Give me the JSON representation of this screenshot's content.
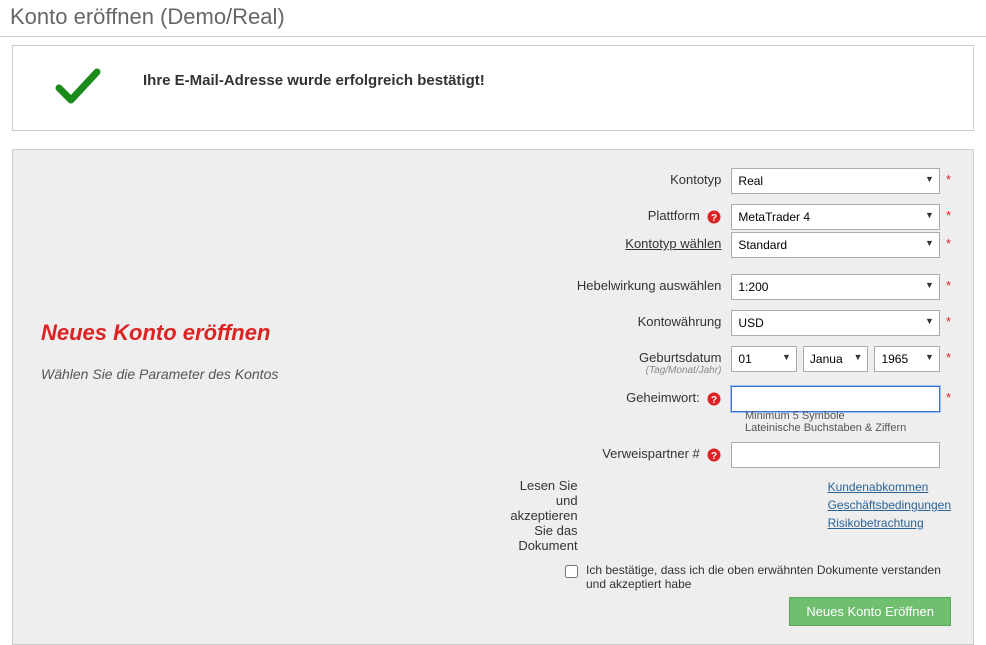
{
  "page_title": "Konto eröffnen (Demo/Real)",
  "success_message": "Ihre E-Mail-Adresse wurde erfolgreich bestätigt!",
  "heading": "Neues Konto eröffnen",
  "subheading": "Wählen Sie die Parameter des Kontos",
  "labels": {
    "account_type": "Kontotyp",
    "platform": "Plattform",
    "choose_type": "Kontotyp wählen",
    "leverage": "Hebelwirkung auswählen",
    "currency": "Kontowährung",
    "dob": "Geburtsdatum",
    "dob_hint": "(Tag/Monat/Jahr)",
    "password": "Geheimwort:",
    "referral": "Verweispartner #",
    "read_docs": "Lesen Sie und akzeptieren Sie das Dokument"
  },
  "values": {
    "account_type": "Real",
    "platform": "MetaTrader 4",
    "choose_type": "Standard",
    "leverage": "1:200",
    "currency": "USD",
    "dob_day": "01",
    "dob_month": "Janua",
    "dob_year": "1965",
    "password": "",
    "referral": ""
  },
  "password_hint1": "Minimum 5 Symbole",
  "password_hint2": "Lateinische Buchstaben & Ziffern",
  "doc_links": {
    "agreement": "Kundenabkommen",
    "terms": "Geschäftsbedingungen",
    "risk": "Risikobetrachtung"
  },
  "confirm_text": "Ich bestätige, dass ich die oben erwähnten Dokumente verstanden und akzeptiert habe",
  "submit_label": "Neues Konto Eröffnen"
}
